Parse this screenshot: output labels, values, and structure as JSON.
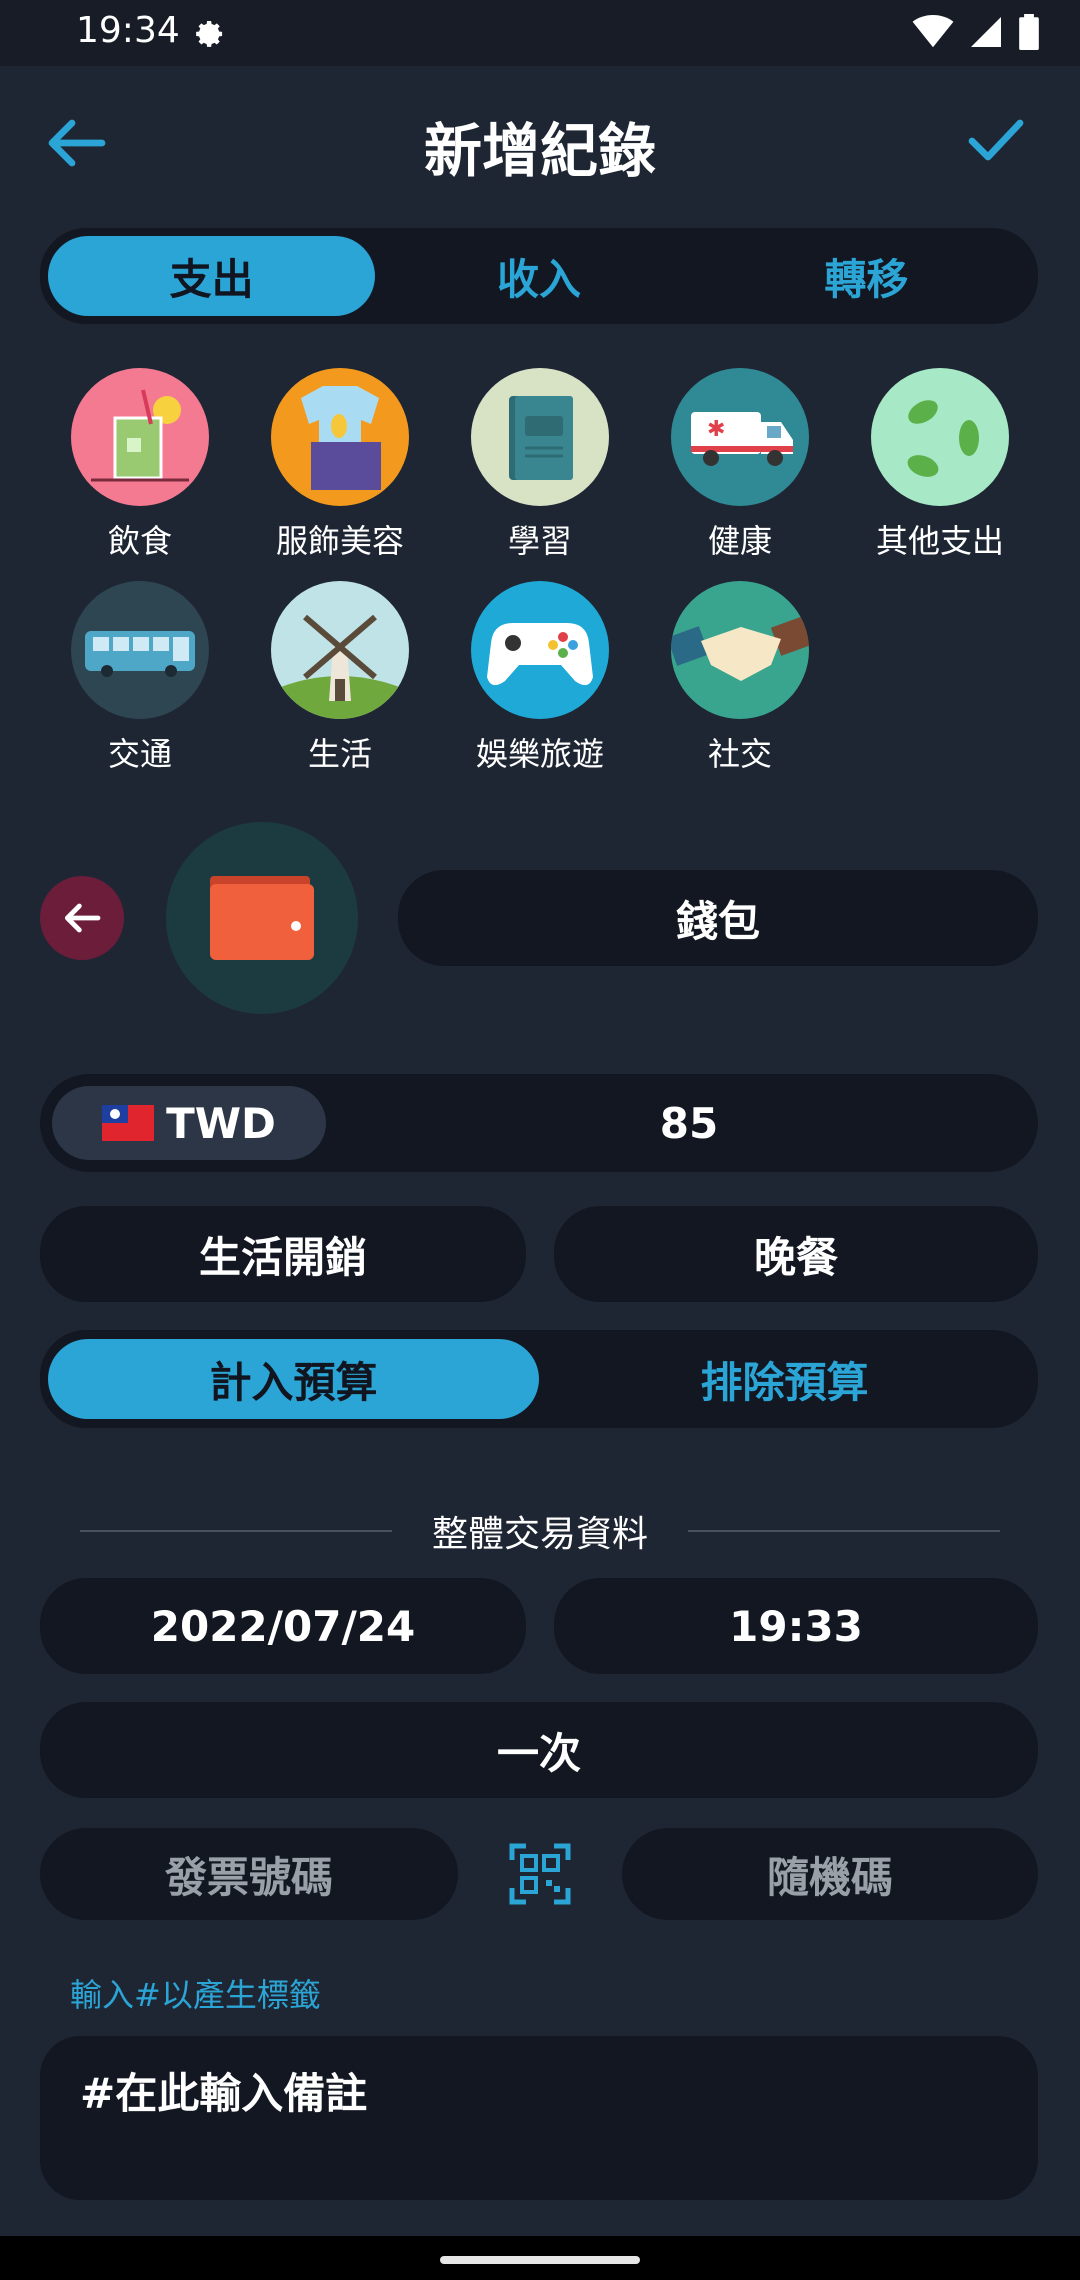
{
  "status": {
    "time": "19:34"
  },
  "header": {
    "title": "新增紀錄"
  },
  "type_tabs": [
    {
      "label": "支出",
      "active": true
    },
    {
      "label": "收入",
      "active": false
    },
    {
      "label": "轉移",
      "active": false
    }
  ],
  "categories": [
    {
      "label": "飲食",
      "icon": "drink-icon"
    },
    {
      "label": "服飾美容",
      "icon": "clothing-icon"
    },
    {
      "label": "學習",
      "icon": "book-icon"
    },
    {
      "label": "健康",
      "icon": "ambulance-icon"
    },
    {
      "label": "其他支出",
      "icon": "leaves-icon"
    },
    {
      "label": "交通",
      "icon": "bus-icon"
    },
    {
      "label": "生活",
      "icon": "windmill-icon"
    },
    {
      "label": "娛樂旅遊",
      "icon": "gamepad-icon"
    },
    {
      "label": "社交",
      "icon": "handshake-icon"
    }
  ],
  "account": {
    "name": "錢包"
  },
  "amount": {
    "currency": "TWD",
    "value": "85"
  },
  "tags": {
    "category": "生活開銷",
    "subcategory": "晚餐"
  },
  "budget_tabs": [
    {
      "label": "計入預算",
      "active": true
    },
    {
      "label": "排除預算",
      "active": false
    }
  ],
  "transaction": {
    "section_title": "整體交易資料",
    "date": "2022/07/24",
    "time": "19:33",
    "repeat": "一次",
    "invoice_placeholder": "發票號碼",
    "random_code_placeholder": "隨機碼"
  },
  "note": {
    "hint": "輸入#以產生標籤",
    "placeholder": "#在此輸入備註"
  },
  "colors": {
    "accent": "#2ba4d6",
    "background": "#1f2633",
    "field": "#121722"
  }
}
